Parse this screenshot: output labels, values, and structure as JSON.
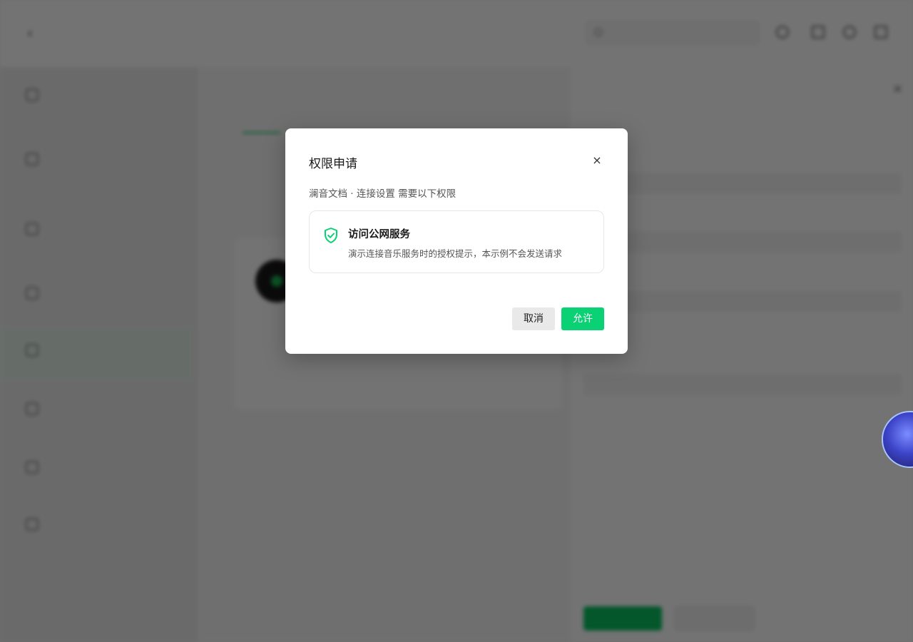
{
  "background": {
    "header": {
      "title": "",
      "search_placeholder": ""
    },
    "colors": {
      "accent": "#07c160",
      "overlay": "rgba(0,0,0,0.55)"
    }
  },
  "dialog": {
    "title": "权限申请",
    "close_label": "×",
    "subtitle": "澜音文档 · 连接设置 需要以下权限",
    "permission": {
      "icon": "shield-check-icon",
      "title": "访问公网服务",
      "description": "演示连接音乐服务时的授权提示，本示例不会发送请求"
    },
    "buttons": {
      "cancel": "取消",
      "allow": "允许"
    },
    "colors": {
      "allow_bg": "#0ad173",
      "shield": "#0ad173"
    }
  }
}
